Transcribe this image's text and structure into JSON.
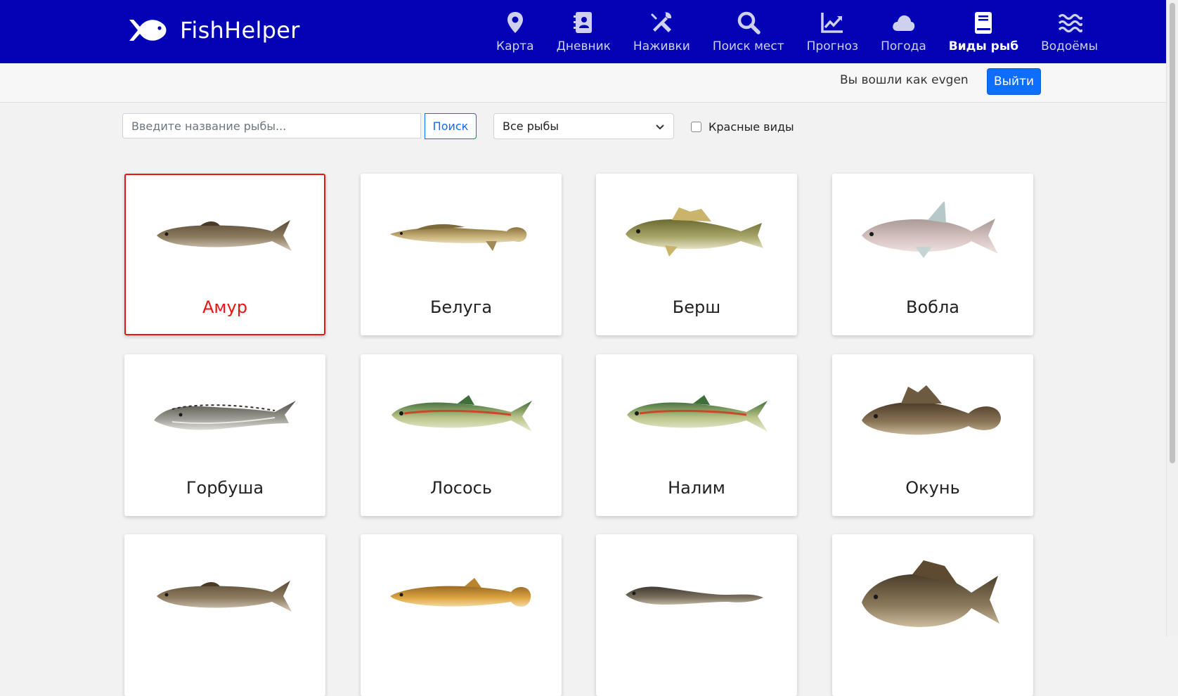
{
  "brand": {
    "name": "FishHelper"
  },
  "nav": [
    {
      "label": "Карта",
      "icon": "map-pin-icon",
      "active": false
    },
    {
      "label": "Дневник",
      "icon": "diary-icon",
      "active": false
    },
    {
      "label": "Наживки",
      "icon": "tools-icon",
      "active": false
    },
    {
      "label": "Поиск мест",
      "icon": "search-icon",
      "active": false
    },
    {
      "label": "Прогноз",
      "icon": "chart-icon",
      "active": false
    },
    {
      "label": "Погода",
      "icon": "cloud-icon",
      "active": false
    },
    {
      "label": "Виды рыб",
      "icon": "book-icon",
      "active": true
    },
    {
      "label": "Водоёмы",
      "icon": "water-icon",
      "active": false
    }
  ],
  "user": {
    "text": "Вы вошли как evgen",
    "logout_label": "Выйти"
  },
  "filters": {
    "search_placeholder": "Введите название рыбы...",
    "search_value": "",
    "search_button": "Поиск",
    "select_value": "Все рыбы",
    "red_species_label": "Красные виды",
    "red_species_checked": false
  },
  "fish": [
    {
      "name": "Амур",
      "selected": true
    },
    {
      "name": "Белуга",
      "selected": false
    },
    {
      "name": "Берш",
      "selected": false
    },
    {
      "name": "Вобла",
      "selected": false
    },
    {
      "name": "Горбуша",
      "selected": false
    },
    {
      "name": "Лосось",
      "selected": false
    },
    {
      "name": "Налим",
      "selected": false
    },
    {
      "name": "Окунь",
      "selected": false
    },
    {
      "name": "",
      "selected": false
    },
    {
      "name": "",
      "selected": false
    },
    {
      "name": "",
      "selected": false
    },
    {
      "name": "",
      "selected": false
    }
  ],
  "colors": {
    "navbar": "#0303b5",
    "accent": "#0d6efd",
    "selected": "#e81515"
  }
}
